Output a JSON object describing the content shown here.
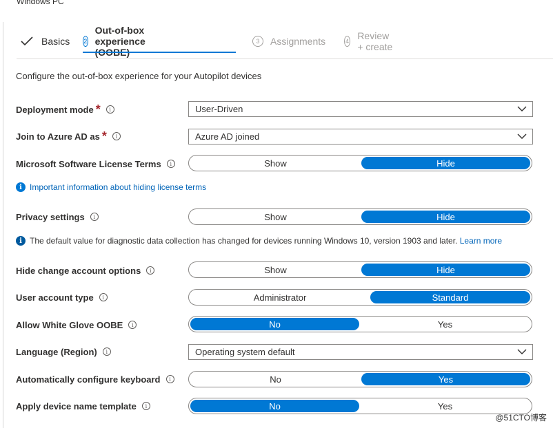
{
  "header": {
    "top_text": "Windows PC"
  },
  "steps": [
    {
      "num": "",
      "label": "Basics",
      "state": "done"
    },
    {
      "num": "2",
      "label": "Out-of-box experience (OOBE)",
      "state": "active"
    },
    {
      "num": "3",
      "label": "Assignments",
      "state": "inactive"
    },
    {
      "num": "4",
      "label": "Review + create",
      "state": "inactive"
    }
  ],
  "intro": "Configure the out-of-box experience for your Autopilot devices",
  "info_glyph": "i",
  "fields": {
    "deployment_mode": {
      "label": "Deployment mode",
      "value": "User-Driven"
    },
    "join_azure": {
      "label": "Join to Azure AD as",
      "value": "Azure AD joined"
    },
    "license_terms": {
      "label": "Microsoft Software License Terms",
      "options": [
        "Show",
        "Hide"
      ],
      "selected": "Hide"
    },
    "license_note": "Important information about hiding license terms",
    "privacy": {
      "label": "Privacy settings",
      "options": [
        "Show",
        "Hide"
      ],
      "selected": "Hide"
    },
    "privacy_note": {
      "text": "The default value for diagnostic data collection has changed for devices running Windows 10, version 1903 and later.",
      "link": "Learn more"
    },
    "hide_change_account": {
      "label": "Hide change account options",
      "options": [
        "Show",
        "Hide"
      ],
      "selected": "Hide"
    },
    "user_account_type": {
      "label": "User account type",
      "options": [
        "Administrator",
        "Standard"
      ],
      "selected": "Standard"
    },
    "white_glove": {
      "label": "Allow White Glove OOBE",
      "options": [
        "No",
        "Yes"
      ],
      "selected": "No"
    },
    "language": {
      "label": "Language (Region)",
      "value": "Operating system default"
    },
    "keyboard": {
      "label": "Automatically configure keyboard",
      "options": [
        "No",
        "Yes"
      ],
      "selected": "Yes"
    },
    "device_name": {
      "label": "Apply device name template",
      "options": [
        "No",
        "Yes"
      ],
      "selected": "No"
    }
  },
  "watermark": "@51CTO博客",
  "colors": {
    "accent": "#0078d4",
    "required": "#a4262c",
    "link": "#0064b8"
  }
}
